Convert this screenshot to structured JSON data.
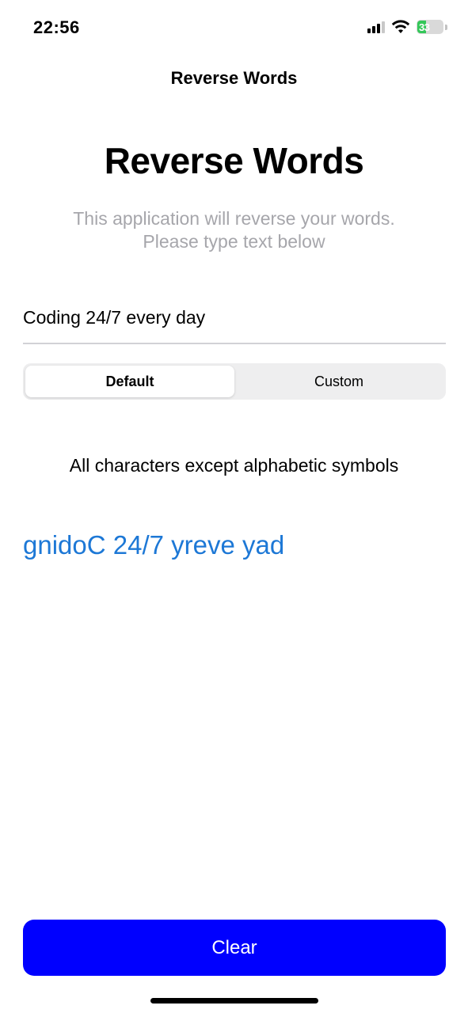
{
  "status_bar": {
    "time": "22:56",
    "battery_level": "33",
    "battery_color": "#34c759",
    "icons": [
      "signal-icon",
      "wifi-icon",
      "battery-icon"
    ]
  },
  "nav": {
    "title": "Reverse Words"
  },
  "header": {
    "title": "Reverse Words",
    "subtitle_line1": "This application will reverse your words.",
    "subtitle_line2": "Please type text below"
  },
  "input": {
    "value": "Coding 24/7 every day",
    "placeholder": ""
  },
  "segmented_control": {
    "options": [
      "Default",
      "Custom"
    ],
    "selected": "Default"
  },
  "mode_description": "All characters except alphabetic symbols",
  "result": {
    "text": "gnidoC 24/7 yreve yad",
    "color": "#1d78d6"
  },
  "clear_button": {
    "label": "Clear",
    "color": "#0000ff"
  }
}
